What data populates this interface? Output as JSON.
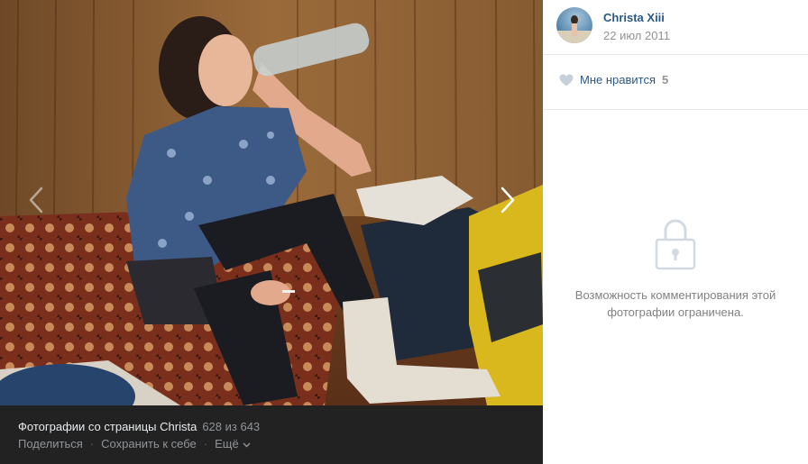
{
  "photo": {
    "alt_icon": "photo-image",
    "album_title": "Фотографии со страницы Christa",
    "counter": "628 из 643",
    "actions": {
      "share": "Поделиться",
      "save": "Сохранить к себе",
      "more": "Ещё"
    }
  },
  "owner": {
    "name": "Christa Xiii",
    "date": "22 июл 2011"
  },
  "likes": {
    "label": "Мне нравится",
    "count": "5"
  },
  "comments": {
    "restricted_text": "Возможность комментирования этой фотографии ограничена."
  },
  "colors": {
    "link": "#2a5885",
    "muted": "#939393",
    "dark_panel": "#222222"
  }
}
